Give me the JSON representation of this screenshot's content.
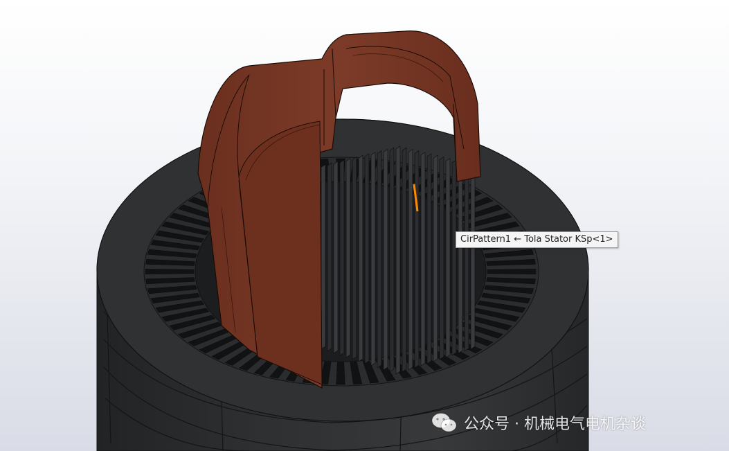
{
  "tooltip": {
    "text": "CirPattern1 ← Tola Stator KSp<1>"
  },
  "watermark": {
    "icon": "wechat-icon",
    "text": "公众号 · 机械电气电机杂谈"
  },
  "colors": {
    "stator": "#2e2f31",
    "stator_edge": "#111111",
    "copper": "#7a3a28",
    "copper_light": "#8d4a33",
    "copper_dark": "#5a2718",
    "highlight": "#ff8a00"
  }
}
